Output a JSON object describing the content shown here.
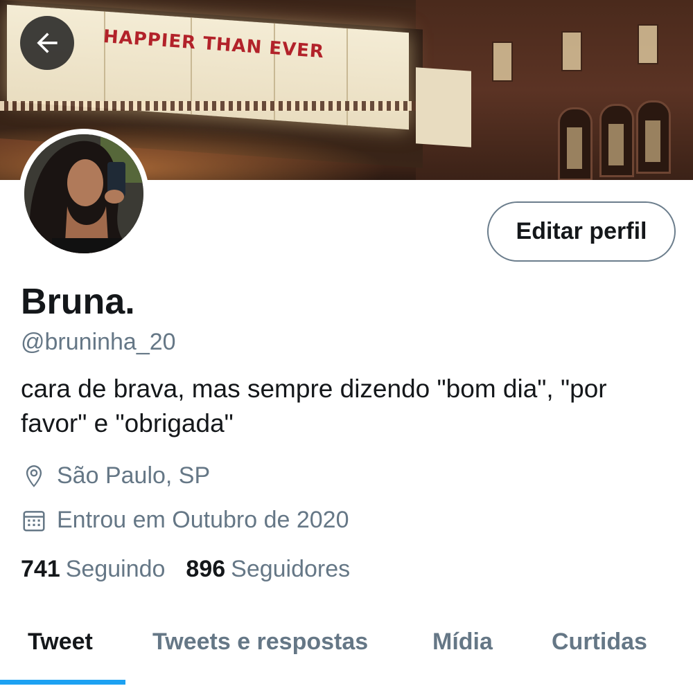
{
  "banner": {
    "marquee_text": "HAPPIER THAN EVER"
  },
  "profile": {
    "display_name": "Bruna.",
    "handle": "@bruninha_20",
    "bio": "cara de brava, mas sempre dizendo \"bom dia\", \"por favor\" e \"obrigada\"",
    "location": "São Paulo, SP",
    "joined": "Entrou em Outubro de 2020",
    "edit_label": "Editar perfil"
  },
  "stats": {
    "following_count": "741",
    "following_label": "Seguindo",
    "followers_count": "896",
    "followers_label": "Seguidores"
  },
  "tabs": [
    {
      "label": "Tweet",
      "active": true
    },
    {
      "label": "Tweets e respostas",
      "active": false
    },
    {
      "label": "Mídia",
      "active": false
    },
    {
      "label": "Curtidas",
      "active": false
    }
  ],
  "icons": {
    "back": "arrow-left-icon",
    "location": "map-pin-icon",
    "joined": "calendar-icon"
  },
  "colors": {
    "accent": "#1da1f2",
    "secondary_text": "#657786",
    "primary_text": "#14171a"
  }
}
